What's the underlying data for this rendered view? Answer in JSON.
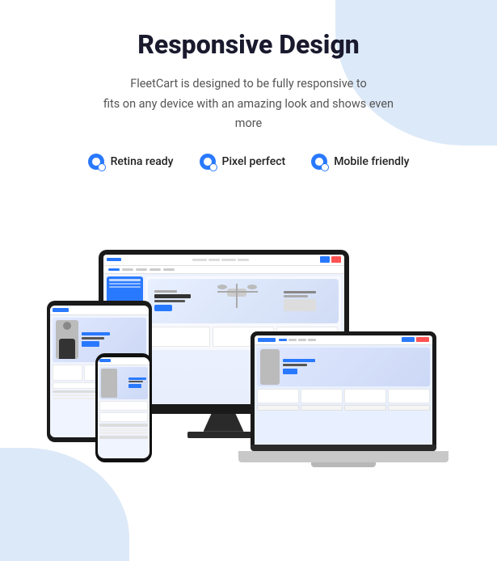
{
  "header": {
    "title": "Responsive Design",
    "subtitle_line1": "FleetCart is designed to be fully responsive to",
    "subtitle_line2": "fits on any device with an amazing look and shows even",
    "subtitle_line3": "more"
  },
  "features": [
    {
      "id": "retina",
      "label": "Retina ready",
      "icon_color": "#2979ff"
    },
    {
      "id": "pixel",
      "label": "Pixel perfect",
      "icon_color": "#2979ff"
    },
    {
      "id": "mobile",
      "label": "Mobile friendly",
      "icon_color": "#2979ff"
    }
  ],
  "colors": {
    "accent": "#2979ff",
    "bg_blob": "#dce9f8",
    "text_dark": "#1a1a2e",
    "text_muted": "#555"
  }
}
